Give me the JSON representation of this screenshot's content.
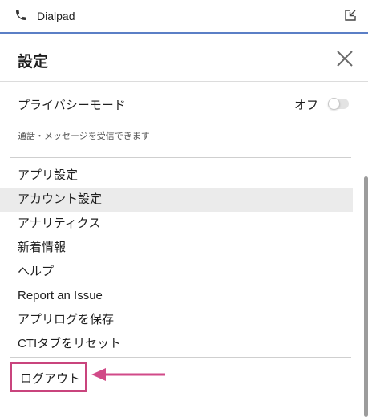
{
  "titlebar": {
    "app_name": "Dialpad",
    "phone_icon": "phone-icon",
    "popout_icon": "popout-icon"
  },
  "settings": {
    "title": "設定",
    "close_icon": "close-icon",
    "privacy": {
      "label": "プライバシーモード",
      "state": "オフ",
      "enabled": false,
      "description": "通話・メッセージを受信できます"
    },
    "menu": [
      {
        "label": "アプリ設定",
        "active": false
      },
      {
        "label": "アカウント設定",
        "active": true
      },
      {
        "label": "アナリティクス",
        "active": false
      },
      {
        "label": "新着情報",
        "active": false
      },
      {
        "label": "ヘルプ",
        "active": false
      },
      {
        "label": "Report an Issue",
        "active": false
      },
      {
        "label": "アプリログを保存",
        "active": false
      },
      {
        "label": "CTIタブをリセット",
        "active": false
      }
    ],
    "logout": {
      "label": "ログアウト"
    }
  },
  "colors": {
    "accent_line": "#5b7fc6",
    "highlight_box": "#c9447d",
    "arrow": "#d14a88",
    "active_row": "#ebebeb"
  }
}
